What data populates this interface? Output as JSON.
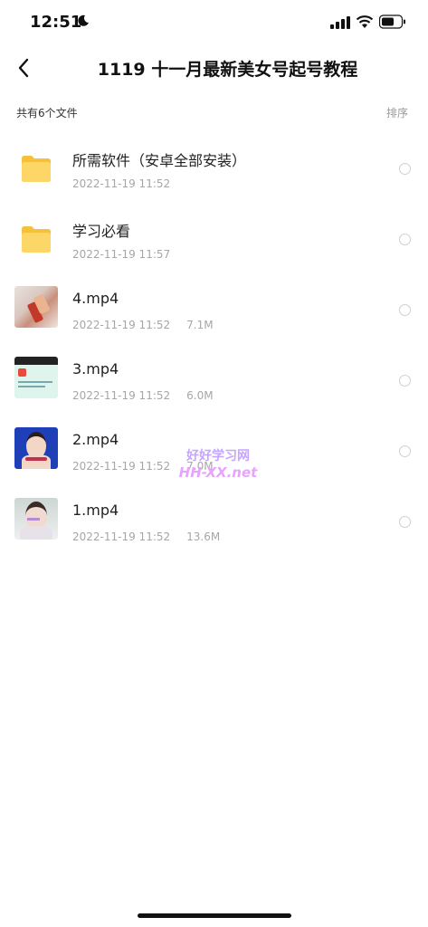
{
  "status": {
    "time": "12:51"
  },
  "header": {
    "title": "1119 十一月最新美女号起号教程"
  },
  "summary": {
    "count_text": "共有6个文件",
    "sort_label": "排序"
  },
  "files": [
    {
      "name": "所需软件（安卓全部安装）",
      "date": "2022-11-19 11:52",
      "size": "",
      "type": "folder",
      "icon": "folder-icon"
    },
    {
      "name": "学习必看",
      "date": "2022-11-19 11:57",
      "size": "",
      "type": "folder",
      "icon": "folder-icon"
    },
    {
      "name": "4.mp4",
      "date": "2022-11-19 11:52",
      "size": "7.1M",
      "type": "video",
      "icon": "video-thumbnail"
    },
    {
      "name": "3.mp4",
      "date": "2022-11-19 11:52",
      "size": "6.0M",
      "type": "video",
      "icon": "video-thumbnail"
    },
    {
      "name": "2.mp4",
      "date": "2022-11-19 11:52",
      "size": "7.0M",
      "type": "video",
      "icon": "video-thumbnail"
    },
    {
      "name": "1.mp4",
      "date": "2022-11-19 11:52",
      "size": "13.6M",
      "type": "video",
      "icon": "video-thumbnail"
    }
  ],
  "watermark": {
    "line1": "好好学习网",
    "line2": "HH-XX.net"
  },
  "colors": {
    "folder": "#f7c94a",
    "radio_border": "#cfcfcf",
    "meta_text": "#a6a6a6"
  }
}
